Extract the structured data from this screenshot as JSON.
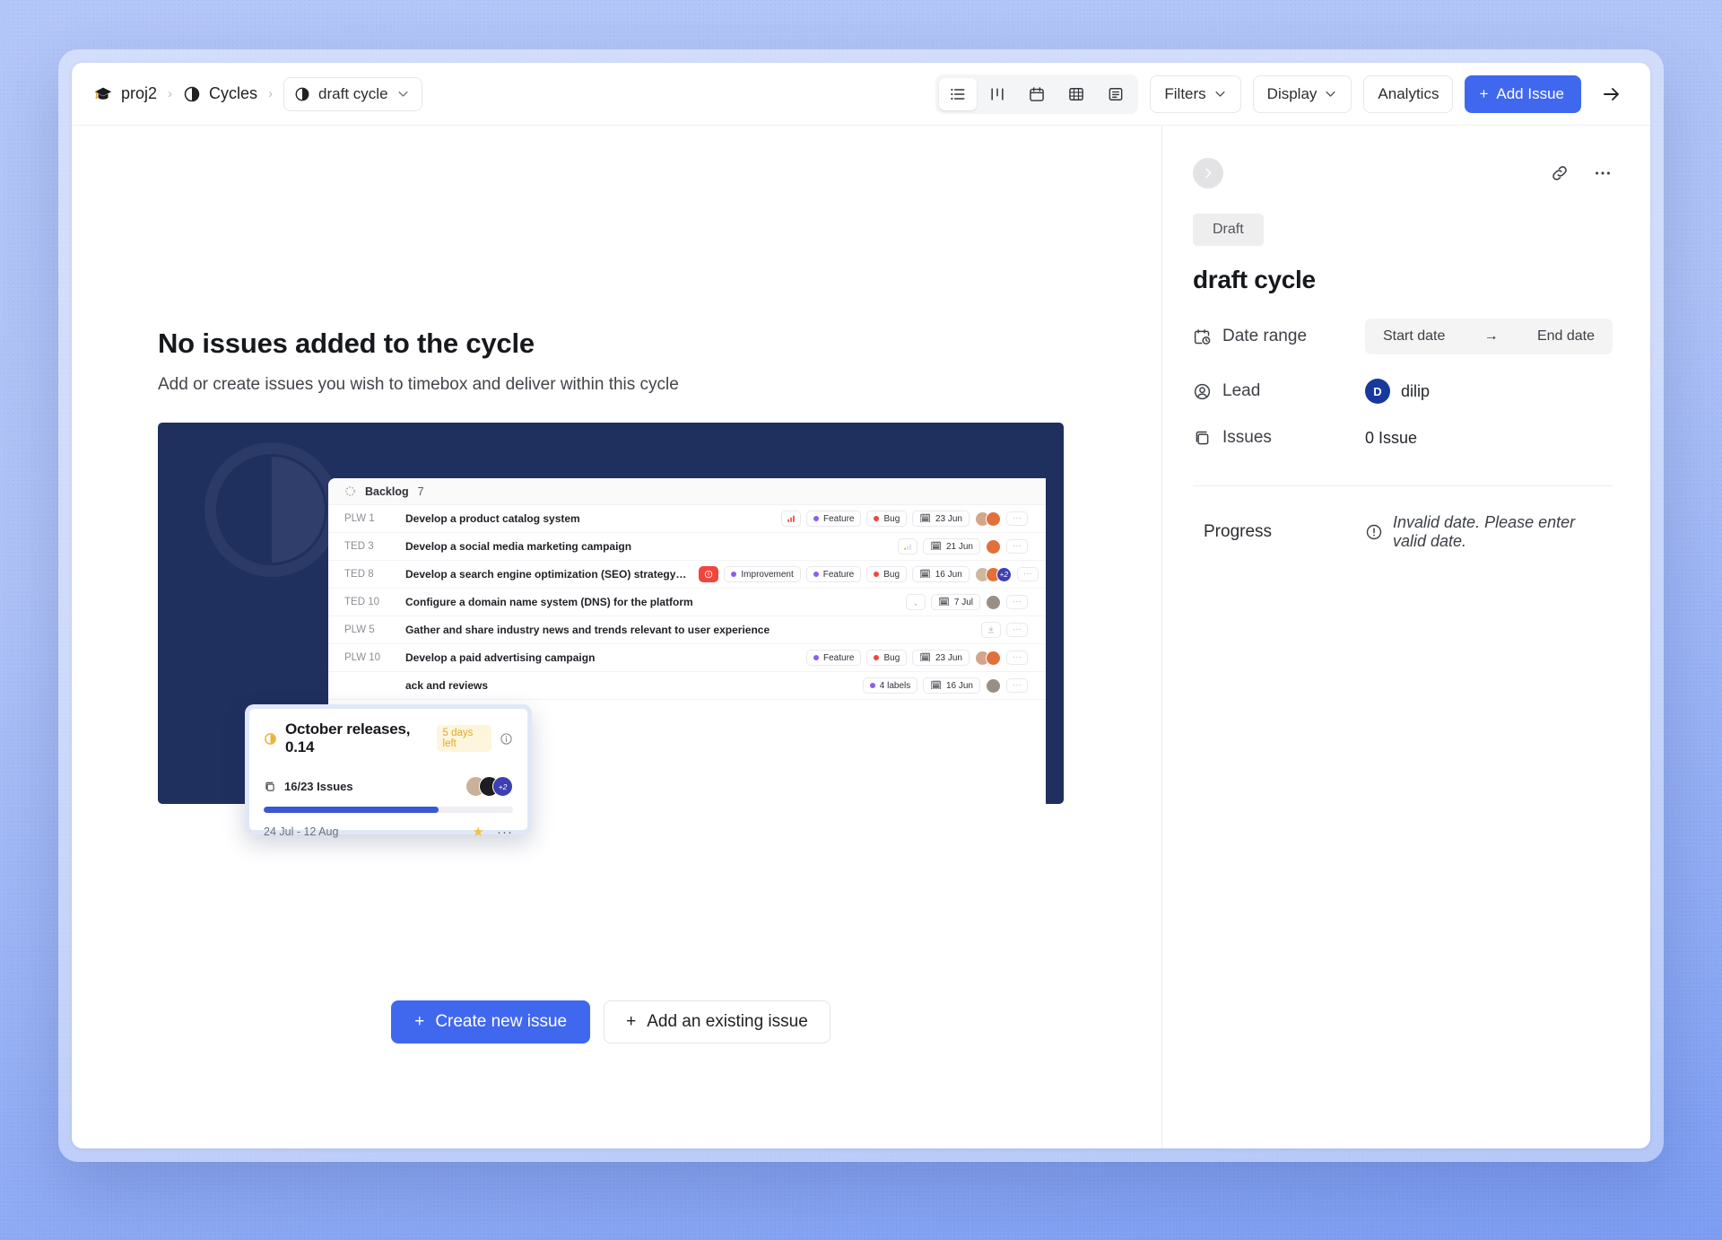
{
  "breadcrumb": {
    "project": "proj2",
    "section": "Cycles",
    "current": "draft cycle",
    "sep": "›"
  },
  "toolbar": {
    "views": [
      {
        "name": "list-view",
        "label": "List",
        "active": true
      },
      {
        "name": "board-view",
        "label": "Board",
        "active": false
      },
      {
        "name": "calendar-view",
        "label": "Calendar",
        "active": false
      },
      {
        "name": "spreadsheet-view",
        "label": "Spreadsheet",
        "active": false
      },
      {
        "name": "gantt-view",
        "label": "Gantt",
        "active": false
      }
    ],
    "filters": "Filters",
    "display": "Display",
    "analytics": "Analytics",
    "add_issue": "Add Issue",
    "plus": "+"
  },
  "empty_state": {
    "title": "No issues added to the cycle",
    "subtitle": "Add or create issues you wish to timebox and deliver within this cycle",
    "create_button": "Create new issue",
    "add_existing_button": "Add an existing issue",
    "plus": "+"
  },
  "illustration": {
    "group_label": "Backlog",
    "group_count": "7",
    "rows": [
      {
        "id": "PLW 1",
        "title": "Develop a product catalog system",
        "tags": [
          "Feature",
          "Bug"
        ],
        "date": "23 Jun",
        "avatars": 2,
        "extra": ""
      },
      {
        "id": "TED 3",
        "title": "Develop a social media marketing campaign",
        "tags": [],
        "date": "21 Jun",
        "avatars": 1,
        "extra": ""
      },
      {
        "id": "TED 8",
        "title": "Develop a search engine optimization (SEO) strategy…",
        "tags": [
          "Improvement",
          "Feature",
          "Bug"
        ],
        "date": "16 Jun",
        "avatars": 2,
        "extra": "+2"
      },
      {
        "id": "TED 10",
        "title": "Configure a domain name system (DNS) for the platform",
        "tags": [],
        "date": "7 Jul",
        "avatars": 1,
        "extra": ""
      },
      {
        "id": "PLW 5",
        "title": "Gather and share industry news and trends relevant to user experience",
        "tags": [],
        "date": "",
        "avatars": 0,
        "extra": ""
      },
      {
        "id": "PLW 10",
        "title": "Develop a paid advertising campaign",
        "tags": [
          "Feature",
          "Bug"
        ],
        "date": "23 Jun",
        "avatars": 2,
        "extra": ""
      },
      {
        "id": "",
        "title": "ack and reviews",
        "tags": [
          "4 labels"
        ],
        "date": "16 Jun",
        "avatars": 1,
        "extra": ""
      }
    ],
    "card": {
      "title": "October releases, 0.14",
      "days_left": "5 days left",
      "issues": "16/23 Issues",
      "progress_percent": 70,
      "dates": "24 Jul - 12 Aug",
      "avatar_extra": "+2"
    }
  },
  "panel": {
    "state": "Draft",
    "title": "draft cycle",
    "date_range_label": "Date range",
    "start_date": "Start date",
    "end_date": "End date",
    "range_arrow": "→",
    "lead_label": "Lead",
    "lead_name": "dilip",
    "lead_initial": "D",
    "issues_label": "Issues",
    "issues_value": "0 Issue",
    "progress_label": "Progress",
    "progress_error": "Invalid date. Please enter valid date."
  },
  "colors": {
    "accent": "#4068ef",
    "illustration_bg": "#1f2f5e",
    "lead_avatar": "#17399e",
    "badge_amber_bg": "#fdf6dd",
    "badge_amber_text": "#dfa92a",
    "feature_dot": "#8b5cf6",
    "bug_dot": "#f2453d",
    "page_bg": "#aec2f7"
  }
}
